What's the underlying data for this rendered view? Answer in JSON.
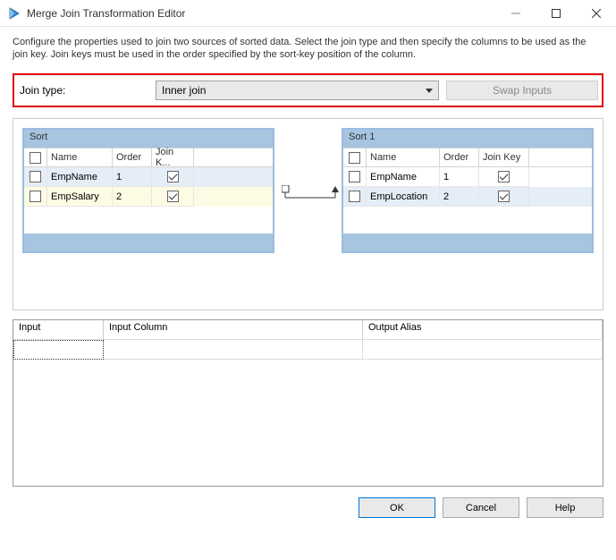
{
  "title": "Merge Join Transformation Editor",
  "description": "Configure the properties used to join two sources of sorted data. Select the join type and then specify the columns to be used as the join key. Join keys must be used in the order specified by the sort-key position of the column.",
  "jointype": {
    "label": "Join type:",
    "value": "Inner join"
  },
  "swap_label": "Swap Inputs",
  "left_panel": {
    "title": "Sort",
    "headers": {
      "name": "Name",
      "order": "Order",
      "key": "Join K..."
    },
    "rows": [
      {
        "name": "EmpName",
        "order": "1",
        "key_checked": true,
        "selected": "sel"
      },
      {
        "name": "EmpSalary",
        "order": "2",
        "key_checked": true,
        "selected": "sel2"
      }
    ]
  },
  "right_panel": {
    "title": "Sort 1",
    "headers": {
      "name": "Name",
      "order": "Order",
      "key": "Join Key"
    },
    "rows": [
      {
        "name": "EmpName",
        "order": "1",
        "key_checked": true,
        "selected": ""
      },
      {
        "name": "EmpLocation",
        "order": "2",
        "key_checked": true,
        "selected": "sel"
      }
    ]
  },
  "lower": {
    "headers": {
      "input": "Input",
      "column": "Input Column",
      "alias": "Output Alias"
    }
  },
  "buttons": {
    "ok": "OK",
    "cancel": "Cancel",
    "help": "Help"
  }
}
